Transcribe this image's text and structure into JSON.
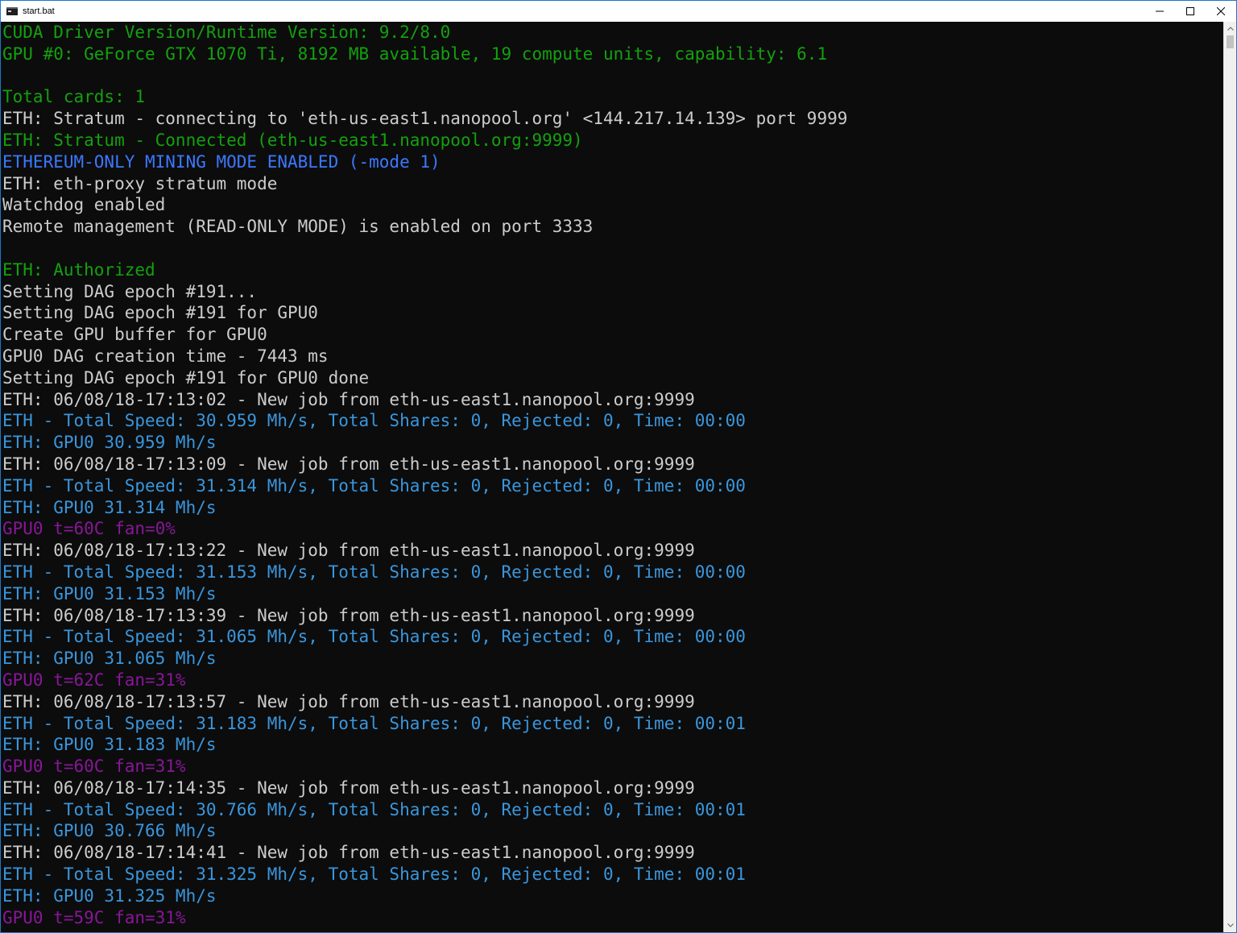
{
  "window": {
    "title": "start.bat",
    "icon": "console-app-icon"
  },
  "controls": {
    "minimize": "minimize-icon",
    "maximize": "maximize-icon",
    "close": "close-icon"
  },
  "colors": {
    "background": "#0c0c0c",
    "white": "#cccccc",
    "green": "#13a10e",
    "blue": "#3b78ff",
    "cyan": "#3a96dd",
    "magenta": "#881798",
    "window_border": "#1979ca"
  },
  "console": {
    "lines": [
      {
        "text": "CUDA Driver Version/Runtime Version: 9.2/8.0",
        "color": "green"
      },
      {
        "text": "GPU #0: GeForce GTX 1070 Ti, 8192 MB available, 19 compute units, capability: 6.1",
        "color": "green"
      },
      {
        "text": "",
        "color": "white"
      },
      {
        "text": "Total cards: 1",
        "color": "green"
      },
      {
        "text": "ETH: Stratum - connecting to 'eth-us-east1.nanopool.org' <144.217.14.139> port 9999",
        "color": "white"
      },
      {
        "text": "ETH: Stratum - Connected (eth-us-east1.nanopool.org:9999)",
        "color": "green"
      },
      {
        "text": "ETHEREUM-ONLY MINING MODE ENABLED (-mode 1)",
        "color": "blue"
      },
      {
        "text": "ETH: eth-proxy stratum mode",
        "color": "white"
      },
      {
        "text": "Watchdog enabled",
        "color": "white"
      },
      {
        "text": "Remote management (READ-ONLY MODE) is enabled on port 3333",
        "color": "white"
      },
      {
        "text": "",
        "color": "white"
      },
      {
        "text": "ETH: Authorized",
        "color": "green"
      },
      {
        "text": "Setting DAG epoch #191...",
        "color": "white"
      },
      {
        "text": "Setting DAG epoch #191 for GPU0",
        "color": "white"
      },
      {
        "text": "Create GPU buffer for GPU0",
        "color": "white"
      },
      {
        "text": "GPU0 DAG creation time - 7443 ms",
        "color": "white"
      },
      {
        "text": "Setting DAG epoch #191 for GPU0 done",
        "color": "white"
      },
      {
        "text": "ETH: 06/08/18-17:13:02 - New job from eth-us-east1.nanopool.org:9999",
        "color": "white"
      },
      {
        "text": "ETH - Total Speed: 30.959 Mh/s, Total Shares: 0, Rejected: 0, Time: 00:00",
        "color": "cyan"
      },
      {
        "text": "ETH: GPU0 30.959 Mh/s",
        "color": "cyan"
      },
      {
        "text": "ETH: 06/08/18-17:13:09 - New job from eth-us-east1.nanopool.org:9999",
        "color": "white"
      },
      {
        "text": "ETH - Total Speed: 31.314 Mh/s, Total Shares: 0, Rejected: 0, Time: 00:00",
        "color": "cyan"
      },
      {
        "text": "ETH: GPU0 31.314 Mh/s",
        "color": "cyan"
      },
      {
        "text": "GPU0 t=60C fan=0%",
        "color": "magenta"
      },
      {
        "text": "ETH: 06/08/18-17:13:22 - New job from eth-us-east1.nanopool.org:9999",
        "color": "white"
      },
      {
        "text": "ETH - Total Speed: 31.153 Mh/s, Total Shares: 0, Rejected: 0, Time: 00:00",
        "color": "cyan"
      },
      {
        "text": "ETH: GPU0 31.153 Mh/s",
        "color": "cyan"
      },
      {
        "text": "ETH: 06/08/18-17:13:39 - New job from eth-us-east1.nanopool.org:9999",
        "color": "white"
      },
      {
        "text": "ETH - Total Speed: 31.065 Mh/s, Total Shares: 0, Rejected: 0, Time: 00:00",
        "color": "cyan"
      },
      {
        "text": "ETH: GPU0 31.065 Mh/s",
        "color": "cyan"
      },
      {
        "text": "GPU0 t=62C fan=31%",
        "color": "magenta"
      },
      {
        "text": "ETH: 06/08/18-17:13:57 - New job from eth-us-east1.nanopool.org:9999",
        "color": "white"
      },
      {
        "text": "ETH - Total Speed: 31.183 Mh/s, Total Shares: 0, Rejected: 0, Time: 00:01",
        "color": "cyan"
      },
      {
        "text": "ETH: GPU0 31.183 Mh/s",
        "color": "cyan"
      },
      {
        "text": "GPU0 t=60C fan=31%",
        "color": "magenta"
      },
      {
        "text": "ETH: 06/08/18-17:14:35 - New job from eth-us-east1.nanopool.org:9999",
        "color": "white"
      },
      {
        "text": "ETH - Total Speed: 30.766 Mh/s, Total Shares: 0, Rejected: 0, Time: 00:01",
        "color": "cyan"
      },
      {
        "text": "ETH: GPU0 30.766 Mh/s",
        "color": "cyan"
      },
      {
        "text": "ETH: 06/08/18-17:14:41 - New job from eth-us-east1.nanopool.org:9999",
        "color": "white"
      },
      {
        "text": "ETH - Total Speed: 31.325 Mh/s, Total Shares: 0, Rejected: 0, Time: 00:01",
        "color": "cyan"
      },
      {
        "text": "ETH: GPU0 31.325 Mh/s",
        "color": "cyan"
      },
      {
        "text": "GPU0 t=59C fan=31%",
        "color": "magenta"
      }
    ]
  },
  "scrollbar": {
    "up": "scroll-up-icon",
    "down": "scroll-down-icon"
  }
}
